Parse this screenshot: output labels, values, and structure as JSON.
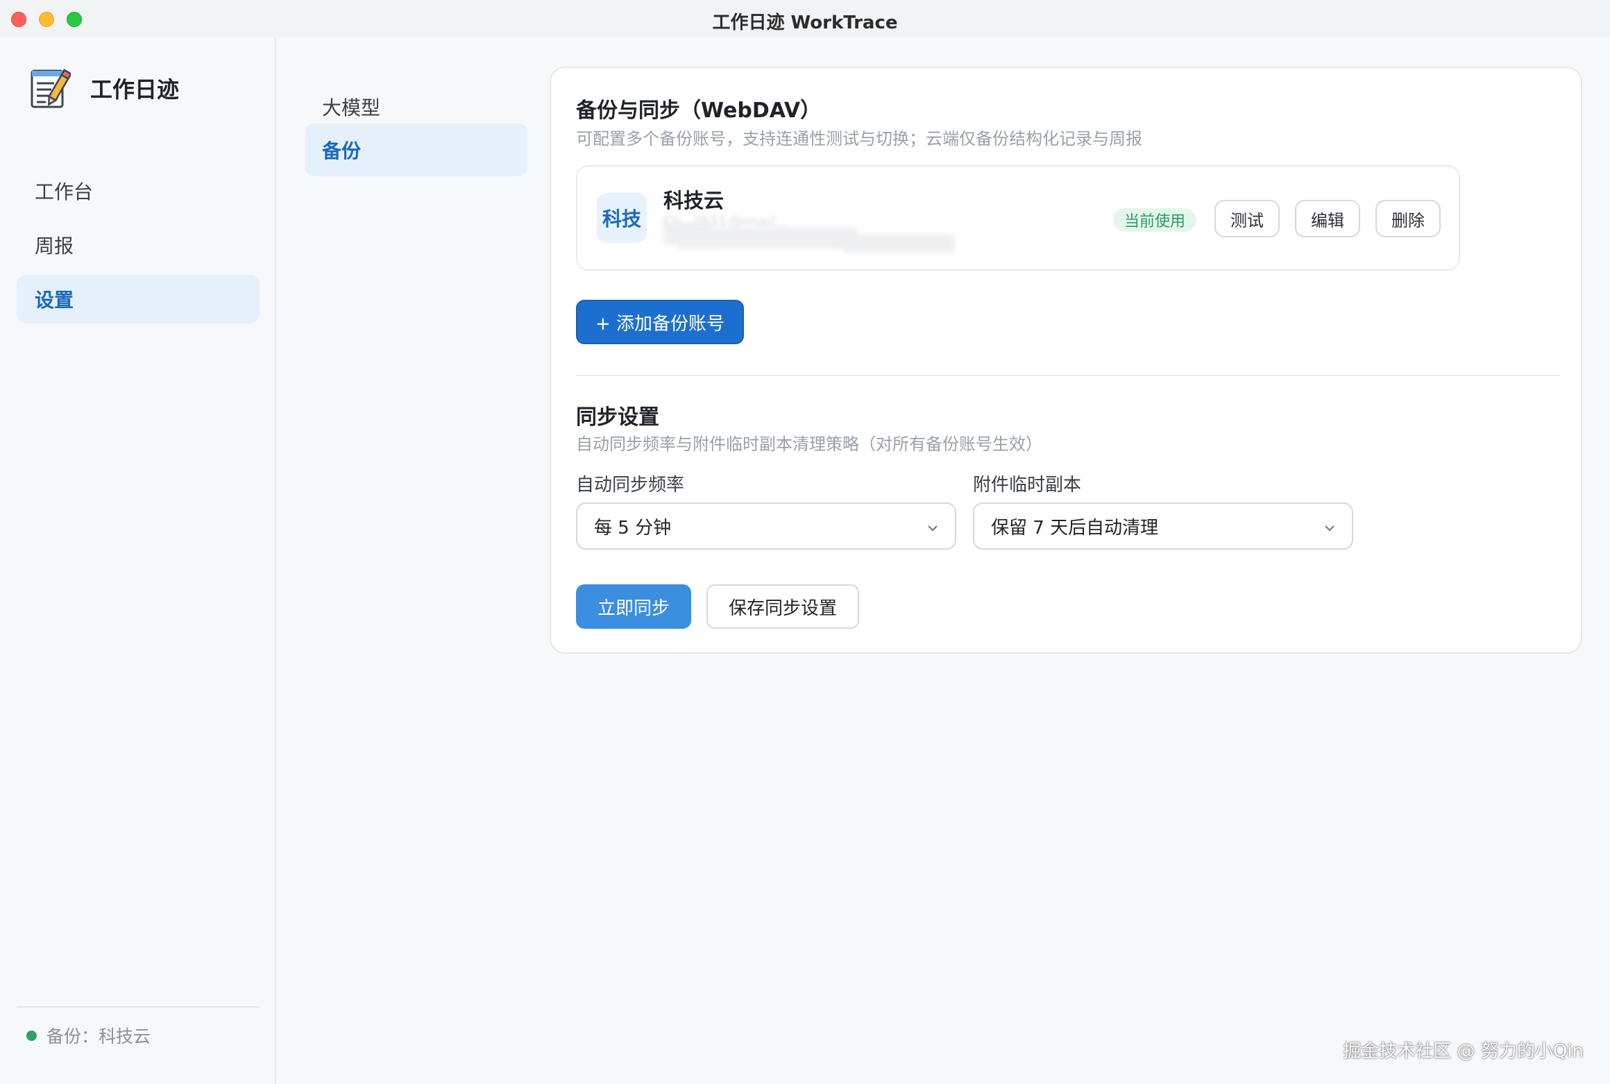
{
  "window": {
    "title": "工作日迹 WorkTrace"
  },
  "sidebar": {
    "brand_title": "工作日迹",
    "items": [
      {
        "label": "工作台",
        "active": false
      },
      {
        "label": "周报",
        "active": false
      },
      {
        "label": "设置",
        "active": true
      }
    ],
    "backup_status": "备份：科技云",
    "status_color": "#2aa36b"
  },
  "subnav": {
    "items": [
      {
        "label": "大模型",
        "active": false
      },
      {
        "label": "备份",
        "active": true
      }
    ]
  },
  "backup": {
    "title": "备份与同步（WebDAV）",
    "subtitle": "可配置多个备份账号，支持连通性测试与切换；云端仅备份结构化记录与周报",
    "account": {
      "avatar_text": "科技",
      "name": "科技云",
      "email_partial": "Qi...l831@mail...",
      "badge": "当前使用",
      "test_label": "测试",
      "edit_label": "编辑",
      "delete_label": "删除"
    },
    "add_label": "+ 添加备份账号"
  },
  "sync": {
    "title": "同步设置",
    "subtitle": "自动同步频率与附件临时副本清理策略（对所有备份账号生效）",
    "frequency_label": "自动同步频率",
    "frequency_value": "每 5 分钟",
    "attachment_label": "附件临时副本",
    "attachment_value": "保留 7 天后自动清理",
    "sync_now_label": "立即同步",
    "save_label": "保存同步设置"
  },
  "watermark": "掘金技术社区 @ 努力的小Qin",
  "colors": {
    "accent": "#1a6ab8",
    "primary_button": "#1d6fcf",
    "badge_bg": "#e3f6ec",
    "badge_text": "#2c9a62"
  }
}
